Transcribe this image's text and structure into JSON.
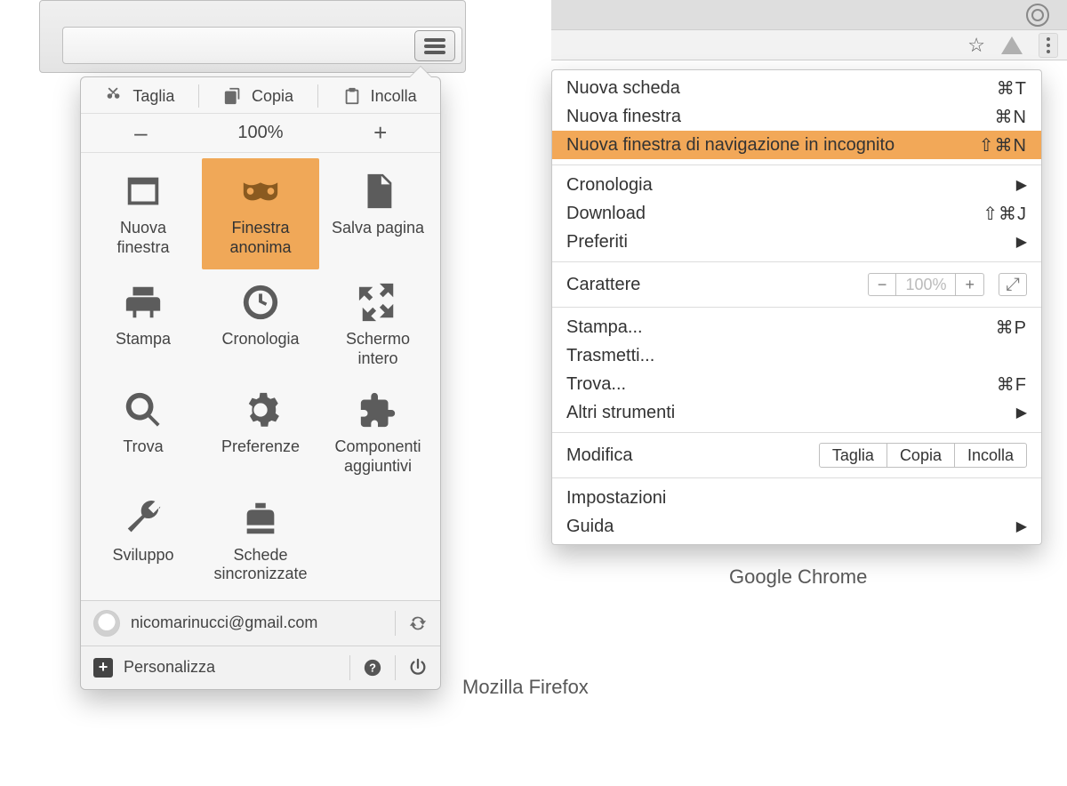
{
  "firefox": {
    "edit": {
      "cut": "Taglia",
      "copy": "Copia",
      "paste": "Incolla"
    },
    "zoom": {
      "minus": "–",
      "value": "100%",
      "plus": "+"
    },
    "grid": {
      "new_window": "Nuova\nfinestra",
      "private_window": "Finestra\nanonima",
      "save_page": "Salva pagina",
      "print": "Stampa",
      "history": "Cronologia",
      "fullscreen": "Schermo\nintero",
      "find": "Trova",
      "preferences": "Preferenze",
      "addons": "Componenti\naggiuntivi",
      "developer": "Sviluppo",
      "synced_tabs": "Schede\nsincronizzate"
    },
    "account": {
      "email": "nicomarinucci@gmail.com"
    },
    "footer": {
      "customize": "Personalizza"
    }
  },
  "chrome": {
    "items": {
      "new_tab": {
        "label": "Nuova scheda",
        "shortcut": "⌘T"
      },
      "new_window": {
        "label": "Nuova finestra",
        "shortcut": "⌘N"
      },
      "incognito": {
        "label": "Nuova finestra di navigazione in incognito",
        "shortcut": "⇧⌘N"
      },
      "history": {
        "label": "Cronologia"
      },
      "downloads": {
        "label": "Download",
        "shortcut": "⇧⌘J"
      },
      "bookmarks": {
        "label": "Preferiti"
      },
      "font": {
        "label": "Carattere",
        "zoom": "100%"
      },
      "print": {
        "label": "Stampa...",
        "shortcut": "⌘P"
      },
      "cast": {
        "label": "Trasmetti..."
      },
      "find": {
        "label": "Trova...",
        "shortcut": "⌘F"
      },
      "more_tools": {
        "label": "Altri strumenti"
      },
      "edit": {
        "label": "Modifica",
        "cut": "Taglia",
        "copy": "Copia",
        "paste": "Incolla"
      },
      "settings": {
        "label": "Impostazioni"
      },
      "help": {
        "label": "Guida"
      }
    }
  },
  "captions": {
    "firefox": "Mozilla Firefox",
    "chrome": "Google Chrome"
  }
}
